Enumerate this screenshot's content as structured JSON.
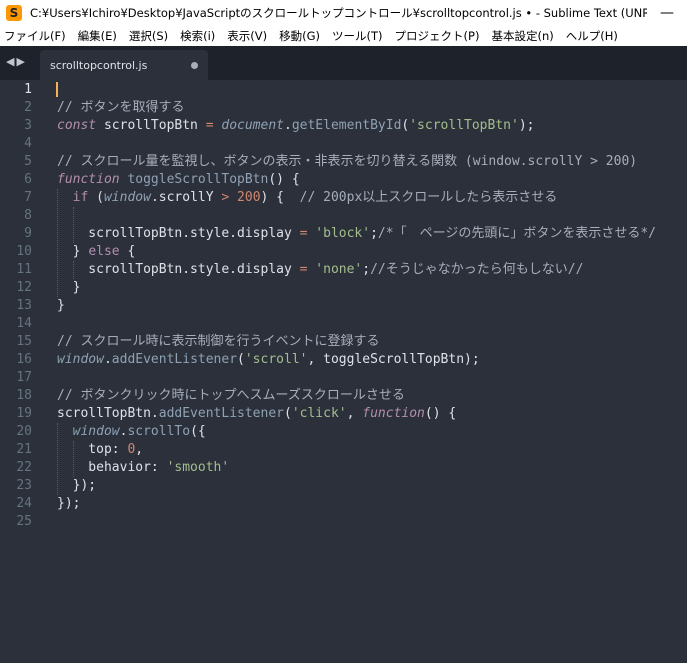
{
  "window": {
    "title": "C:¥Users¥Ichiro¥Desktop¥JavaScriptのスクロールトップコントロール¥scrolltopcontrol.js • - Sublime Text (UNREGISTERED)",
    "minimize_symbol": "—"
  },
  "menu": [
    "ファイル(F)",
    "編集(E)",
    "選択(S)",
    "検索(i)",
    "表示(V)",
    "移動(G)",
    "ツール(T)",
    "プロジェクト(P)",
    "基本設定(n)",
    "ヘルプ(H)"
  ],
  "tab": {
    "label": "scrolltopcontrol.js"
  },
  "colors": {
    "background": "#2b303b",
    "comment": "#a7adba",
    "keyword": "#b48ead",
    "string": "#a3be8c",
    "number": "#d08770",
    "operator": "#d08770",
    "builtin": "#8fa1b3",
    "plain": "#dfe1e8",
    "property": "#8fa1b3"
  },
  "editor": {
    "active_line": 1,
    "line_count": 25,
    "lines": [
      [],
      [
        [
          "// ボタンを取得する",
          "comment"
        ]
      ],
      [
        [
          "const",
          "keyword-i"
        ],
        [
          " scrollTopBtn ",
          "plain"
        ],
        [
          "=",
          "operator"
        ],
        [
          " ",
          "plain"
        ],
        [
          "document",
          "builtin-i"
        ],
        [
          ".",
          "plain"
        ],
        [
          "getElementById",
          "builtin"
        ],
        [
          "(",
          "plain"
        ],
        [
          "'scrollTopBtn'",
          "string"
        ],
        [
          ");",
          "plain"
        ]
      ],
      [],
      [
        [
          "// スクロール量を監視し、ボタンの表示・非表示を切り替える関数 (window.scrollY > 200)",
          "comment"
        ]
      ],
      [
        [
          "function",
          "keyword-i"
        ],
        [
          " ",
          "plain"
        ],
        [
          "toggleScrollTopBtn",
          "fn"
        ],
        [
          "() {",
          "plain"
        ]
      ],
      [
        [
          "  ",
          "plain"
        ],
        [
          "if",
          "keyword"
        ],
        [
          " (",
          "plain"
        ],
        [
          "window",
          "builtin-i"
        ],
        [
          ".scrollY ",
          "plain"
        ],
        [
          ">",
          "operator"
        ],
        [
          " ",
          "plain"
        ],
        [
          "200",
          "number"
        ],
        [
          ") {  ",
          "plain"
        ],
        [
          "// 200px以上スクロールしたら表示させる",
          "comment"
        ]
      ],
      [],
      [
        [
          "    scrollTopBtn.style.display ",
          "plain"
        ],
        [
          "=",
          "operator"
        ],
        [
          " ",
          "plain"
        ],
        [
          "'block'",
          "string"
        ],
        [
          ";",
          "plain"
        ],
        [
          "/*「　ページの先頭に」ボタンを表示させる*/",
          "comment"
        ]
      ],
      [
        [
          "  } ",
          "plain"
        ],
        [
          "else",
          "keyword"
        ],
        [
          " {",
          "plain"
        ]
      ],
      [
        [
          "    scrollTopBtn.style.display ",
          "plain"
        ],
        [
          "=",
          "operator"
        ],
        [
          " ",
          "plain"
        ],
        [
          "'none'",
          "string"
        ],
        [
          ";",
          "plain"
        ],
        [
          "//そうじゃなかったら何もしない//",
          "comment"
        ]
      ],
      [
        [
          "  }",
          "plain"
        ]
      ],
      [
        [
          "}",
          "plain"
        ]
      ],
      [],
      [
        [
          "// スクロール時に表示制御を行うイベントに登録する",
          "comment"
        ]
      ],
      [
        [
          "window",
          "builtin-i"
        ],
        [
          ".",
          "plain"
        ],
        [
          "addEventListener",
          "builtin"
        ],
        [
          "(",
          "plain"
        ],
        [
          "'scroll'",
          "string"
        ],
        [
          ", toggleScrollTopBtn);",
          "plain"
        ]
      ],
      [],
      [
        [
          "// ボタンクリック時にトップへスムーズスクロールさせる",
          "comment"
        ]
      ],
      [
        [
          "scrollTopBtn.",
          "plain"
        ],
        [
          "addEventListener",
          "builtin"
        ],
        [
          "(",
          "plain"
        ],
        [
          "'click'",
          "string"
        ],
        [
          ", ",
          "plain"
        ],
        [
          "function",
          "keyword-i"
        ],
        [
          "() {",
          "plain"
        ]
      ],
      [
        [
          "  ",
          "plain"
        ],
        [
          "window",
          "builtin-i"
        ],
        [
          ".",
          "plain"
        ],
        [
          "scrollTo",
          "builtin"
        ],
        [
          "({",
          "plain"
        ]
      ],
      [
        [
          "    top: ",
          "plain"
        ],
        [
          "0",
          "number"
        ],
        [
          ",",
          "plain"
        ]
      ],
      [
        [
          "    behavior: ",
          "plain"
        ],
        [
          "'smooth'",
          "string"
        ]
      ],
      [
        [
          "  });",
          "plain"
        ]
      ],
      [
        [
          "});",
          "plain"
        ]
      ],
      []
    ]
  }
}
